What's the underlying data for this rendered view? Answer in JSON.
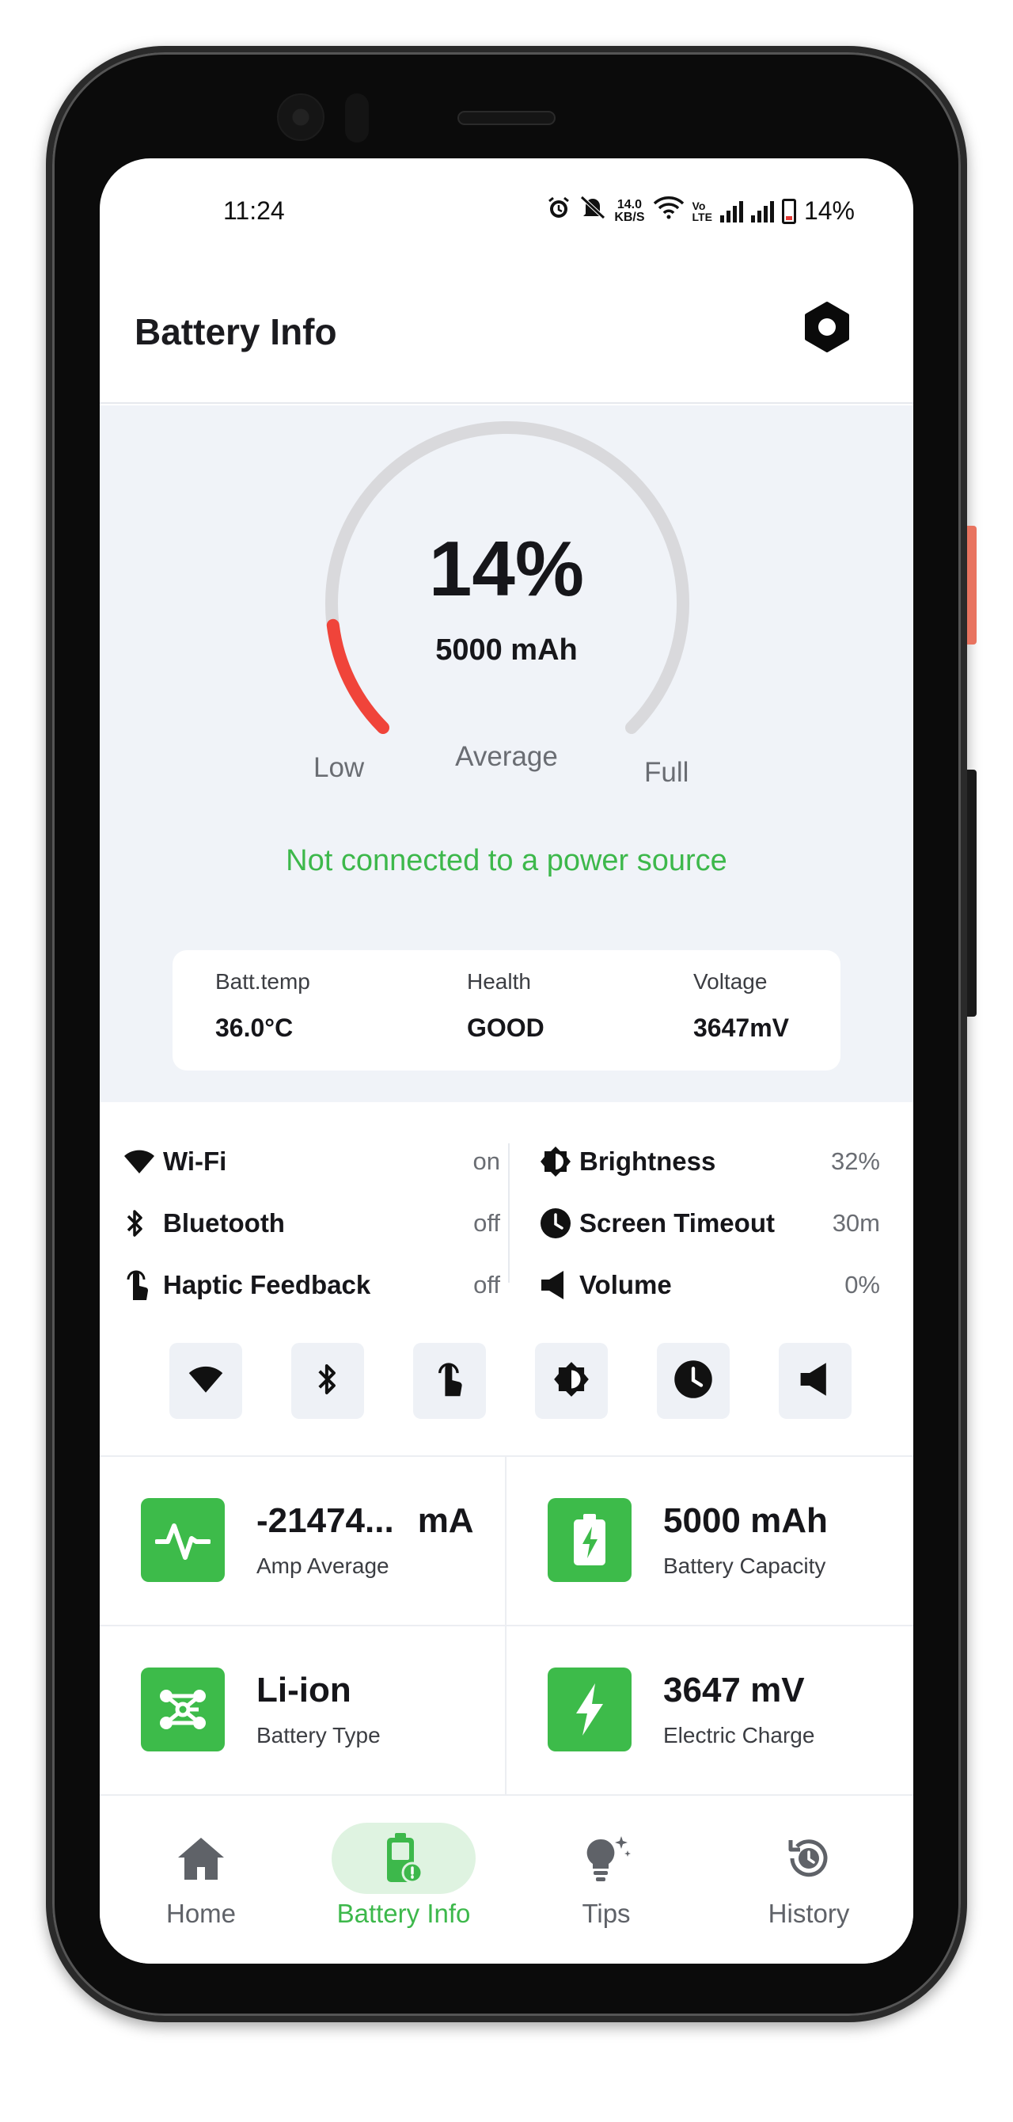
{
  "status_bar": {
    "time": "11:24",
    "net_speed_value": "14.0",
    "net_speed_unit": "KB/S",
    "volte_top": "Vo",
    "volte_bottom": "LTE",
    "battery_percent": "14%"
  },
  "app_bar": {
    "title": "Battery Info",
    "settings_icon": "settings-icon"
  },
  "gauge": {
    "percent_label": "14%",
    "percent_value": 14,
    "capacity": "5000 mAh",
    "low_label": "Low",
    "average_label": "Average",
    "full_label": "Full",
    "track_color": "#d9d9dc",
    "fill_color": "#f0443a"
  },
  "power_status": "Not connected to a power source",
  "stats": [
    {
      "label": "Batt.temp",
      "value": "36.0°C"
    },
    {
      "label": "Health",
      "value": "GOOD"
    },
    {
      "label": "Voltage",
      "value": "3647mV"
    }
  ],
  "system_settings": {
    "left": [
      {
        "icon": "wifi-icon",
        "label": "Wi-Fi",
        "value": "on"
      },
      {
        "icon": "bluetooth-icon",
        "label": "Bluetooth",
        "value": "off"
      },
      {
        "icon": "touch-icon",
        "label": "Haptic Feedback",
        "value": "off"
      }
    ],
    "right": [
      {
        "icon": "brightness-icon",
        "label": "Brightness",
        "value": "32%"
      },
      {
        "icon": "clock-icon",
        "label": "Screen Timeout",
        "value": "30m"
      },
      {
        "icon": "volume-icon",
        "label": "Volume",
        "value": "0%"
      }
    ]
  },
  "quick_toggles": [
    "wifi-icon",
    "bluetooth-icon",
    "touch-icon",
    "brightness-icon",
    "clock-icon",
    "volume-icon"
  ],
  "metrics": [
    {
      "icon": "pulse-icon",
      "value": "-21474...",
      "unit": "mA",
      "label": "Amp Average"
    },
    {
      "icon": "battery-charge-icon",
      "value": "5000 mAh",
      "unit": "",
      "label": "Battery Capacity"
    },
    {
      "icon": "molecule-icon",
      "value": "Li-ion",
      "unit": "",
      "label": "Battery Type"
    },
    {
      "icon": "bolt-icon",
      "value": "3647 mV",
      "unit": "",
      "label": "Electric Charge"
    }
  ],
  "bottom_nav": [
    {
      "icon": "home-icon",
      "label": "Home",
      "active": false
    },
    {
      "icon": "battery-info-icon",
      "label": "Battery Info",
      "active": true
    },
    {
      "icon": "lightbulb-icon",
      "label": "Tips",
      "active": false
    },
    {
      "icon": "history-icon",
      "label": "History",
      "active": false
    }
  ],
  "colors": {
    "accent_green": "#3db84b",
    "tile_green": "#3dbb4a",
    "gauge_red": "#f0443a",
    "section_bg": "#f0f3f8"
  }
}
